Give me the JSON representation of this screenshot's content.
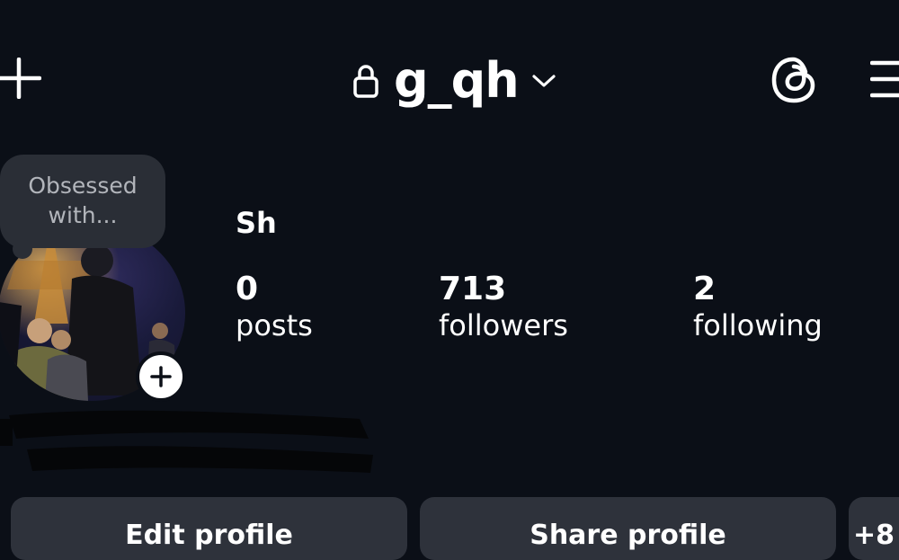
{
  "header": {
    "username": "g_qh"
  },
  "note": {
    "text": "Obsessed with..."
  },
  "profile": {
    "display_name": "Sh"
  },
  "stats": [
    {
      "value": "0",
      "label": "posts"
    },
    {
      "value": "713",
      "label": "followers"
    },
    {
      "value": "2",
      "label": "following"
    }
  ],
  "actions": {
    "edit_profile": "Edit profile",
    "share_profile": "Share profile",
    "discover_people": "+8"
  },
  "icons": {
    "create": "plus-icon",
    "private": "lock-icon",
    "account_switcher": "chevron-down-icon",
    "threads": "threads-icon",
    "menu": "hamburger-menu-icon",
    "add_story": "plus-icon"
  },
  "colors": {
    "background": "#0b0f17",
    "button": "#2e323b",
    "note_bubble": "#2a2e36",
    "text": "#ffffff"
  }
}
